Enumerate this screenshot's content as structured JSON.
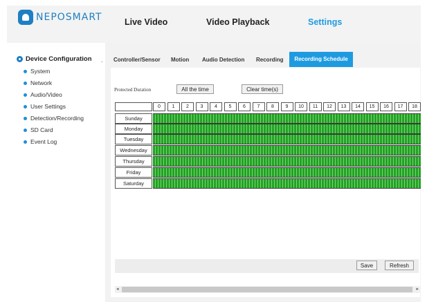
{
  "brand": {
    "name": "NEPOSMART"
  },
  "top_nav": [
    {
      "label": "Live Video",
      "active": false
    },
    {
      "label": "Video Playback",
      "active": false
    },
    {
      "label": "Settings",
      "active": true
    }
  ],
  "sidebar": {
    "section_title": "Device Configuration",
    "caret": ".",
    "items": [
      {
        "label": "System"
      },
      {
        "label": "Network"
      },
      {
        "label": "Audio/Video"
      },
      {
        "label": "User Settings"
      },
      {
        "label": "Detection/Recording"
      },
      {
        "label": "SD Card"
      },
      {
        "label": "Event Log"
      }
    ]
  },
  "tabs": [
    {
      "label": "Controller/Sensor"
    },
    {
      "label": "Motion"
    },
    {
      "label": "Audio Detection"
    },
    {
      "label": "Recording"
    },
    {
      "label": "Recording Schedule",
      "active": true
    }
  ],
  "schedule": {
    "protected_label": "Protected Duration",
    "all_time_label": "All the time",
    "clear_label": "Clear time(s)",
    "hours": [
      "0",
      "1",
      "2",
      "3",
      "4",
      "5",
      "6",
      "7",
      "8",
      "9",
      "10",
      "11",
      "12",
      "13",
      "14",
      "15",
      "16",
      "17",
      "18"
    ],
    "days": [
      "Sunday",
      "Monday",
      "Tuesday",
      "Wednesday",
      "Thursday",
      "Friday",
      "Saturday"
    ]
  },
  "actions": {
    "save_label": "Save",
    "refresh_label": "Refresh"
  },
  "colors": {
    "accent": "#1e9be0",
    "brand": "#1e7fc2",
    "scheduled": "#22a322"
  }
}
